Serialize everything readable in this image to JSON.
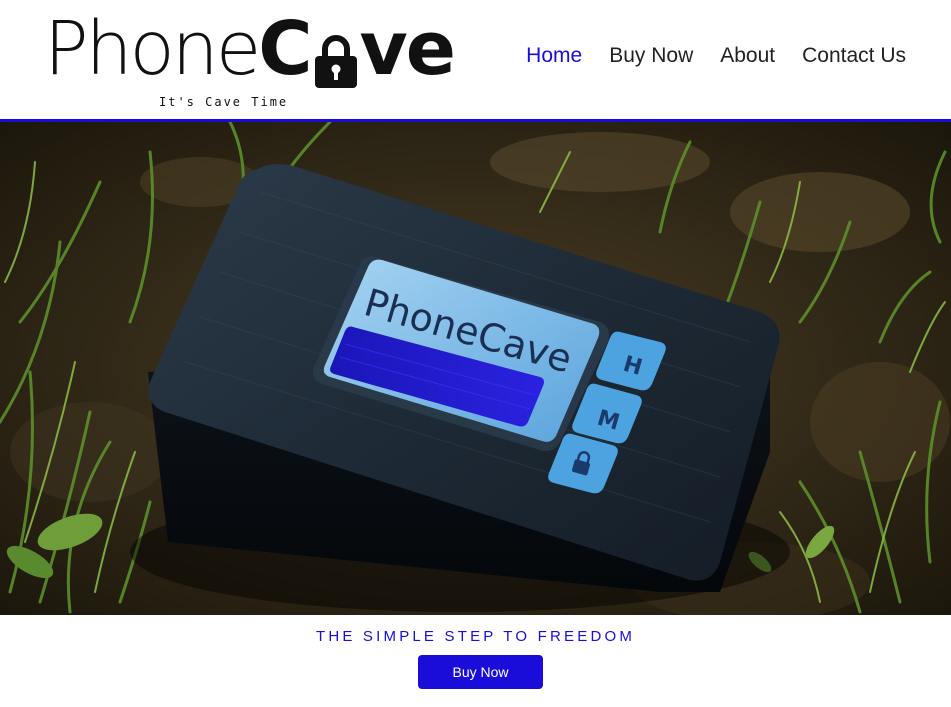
{
  "header": {
    "logo_text_1": "Phone",
    "logo_text_2": "C",
    "logo_text_3": "ve",
    "tagline": "It's Cave Time"
  },
  "nav": {
    "items": [
      {
        "label": "Home",
        "active": true
      },
      {
        "label": "Buy Now",
        "active": false
      },
      {
        "label": "About",
        "active": false
      },
      {
        "label": "Contact Us",
        "active": false
      }
    ]
  },
  "hero": {
    "device_logo": "PhoneCave",
    "button_h": "H",
    "button_m": "M"
  },
  "cta": {
    "headline": "THE SIMPLE STEP TO FREEDOM",
    "button_label": "Buy Now"
  },
  "colors": {
    "accent": "#1a0dda",
    "text": "#222222",
    "background": "#ffffff"
  }
}
